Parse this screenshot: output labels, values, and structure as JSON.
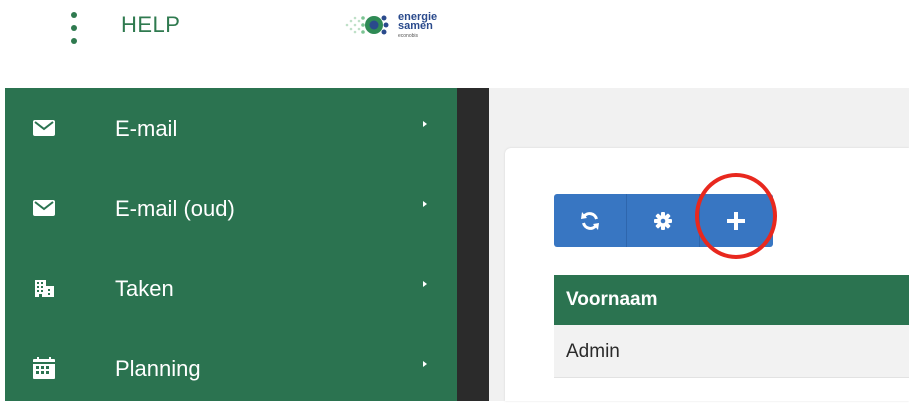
{
  "topbar": {
    "menu_icon": "kebab-menu-icon",
    "help_label": "HELP",
    "logo": {
      "line1": "energie",
      "line2": "samen",
      "line3": "econobis",
      "colors": {
        "brand_blue": "#2a4a8c",
        "brand_green": "#4caf6e"
      }
    }
  },
  "sidebar": {
    "background": "#2b7350",
    "items": [
      {
        "label": "E-mail",
        "icon": "envelope-icon"
      },
      {
        "label": "E-mail (oud)",
        "icon": "envelope-icon"
      },
      {
        "label": "Taken",
        "icon": "building-icon"
      },
      {
        "label": "Planning",
        "icon": "calendar-icon"
      }
    ]
  },
  "toolbar": {
    "color": "#3876c2",
    "buttons": [
      {
        "icon": "refresh-icon"
      },
      {
        "icon": "gear-icon"
      },
      {
        "icon": "plus-icon"
      }
    ],
    "highlight_color": "#e8281e"
  },
  "table": {
    "header_color": "#2b7350",
    "columns": [
      "Voornaam"
    ],
    "rows": [
      [
        "Admin"
      ]
    ]
  }
}
